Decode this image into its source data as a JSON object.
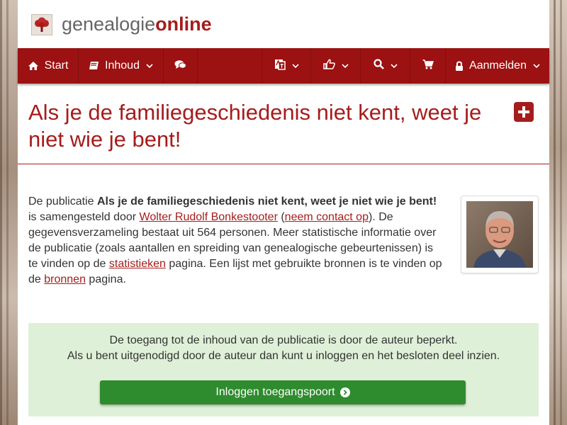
{
  "brand": {
    "name_part1": "genealogie",
    "name_part2": "online"
  },
  "navbar": {
    "start": "Start",
    "contents": "Inhoud",
    "login": "Aanmelden"
  },
  "page": {
    "title": "Als je de familiegeschiedenis niet kent, weet je niet wie je bent!"
  },
  "intro": {
    "t1": "De publicatie ",
    "pub_title": "Als je de familiegeschiedenis niet kent, weet je niet wie je bent!",
    "t2": " is samengesteld door ",
    "author": "Wolter Rudolf Bonkestooter",
    "t3": " (",
    "contact": "neem contact op",
    "t4": "). De gegevensverzameling bestaat uit 564 personen. Meer statistische informatie over de publicatie (zoals aantallen en spreiding van genealogische gebeurtenissen) is te vinden op de ",
    "stats": "statistieken",
    "t5": " pagina. Een lijst met gebruikte bronnen is te vinden op de ",
    "sources": "bronnen",
    "t6": " pagina."
  },
  "access": {
    "line1": "De toegang tot de inhoud van de publicatie is door de auteur beperkt.",
    "line2": "Als u bent uitgenodigd door de auteur dan kunt u inloggen en het besloten deel inzien.",
    "button": "Inloggen toegangspoort"
  },
  "colors": {
    "brand": "#a61c1c",
    "navbar": "#9c1111",
    "success": "#2e8b2e",
    "access_bg": "#dff0d8"
  }
}
